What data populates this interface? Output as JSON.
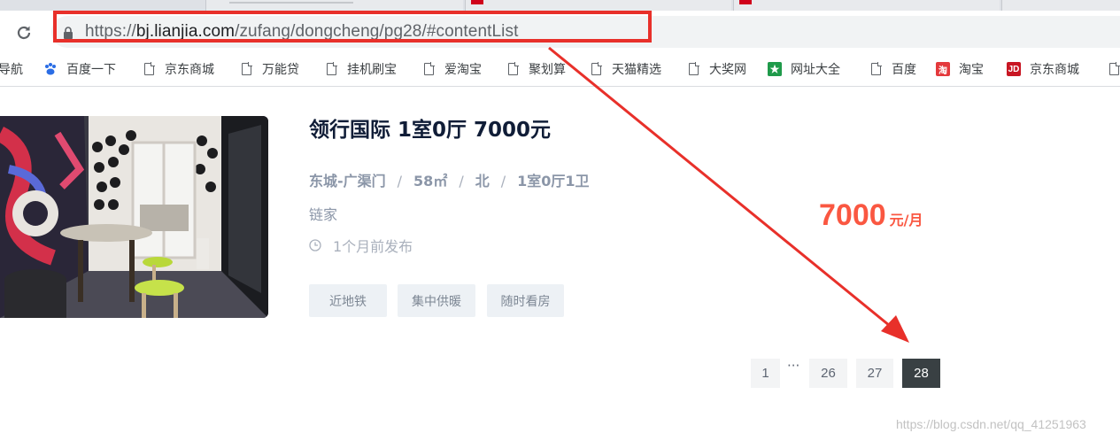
{
  "browser": {
    "url_host_prefix": "https://",
    "url_host": "bj.lianjia.com",
    "url_path": "/zufang/dongcheng/pg28/#contentList"
  },
  "bookmarks": [
    {
      "label": "导航",
      "icon": "page-icon"
    },
    {
      "label": "百度一下",
      "icon": "baidu-paw-icon"
    },
    {
      "label": "京东商城",
      "icon": "page-icon"
    },
    {
      "label": "万能贷",
      "icon": "page-icon"
    },
    {
      "label": "挂机刷宝",
      "icon": "page-icon"
    },
    {
      "label": "爱淘宝",
      "icon": "page-icon"
    },
    {
      "label": "聚划算",
      "icon": "page-icon"
    },
    {
      "label": "天猫精选",
      "icon": "page-icon"
    },
    {
      "label": "大奖网",
      "icon": "page-icon"
    },
    {
      "label": "网址大全",
      "icon": "web-directory-icon"
    },
    {
      "label": "百度",
      "icon": "page-icon"
    },
    {
      "label": "淘宝",
      "icon": "taobao-icon",
      "badge_text": "淘"
    },
    {
      "label": "京东商城",
      "icon": "jd-icon",
      "badge_text": "JD"
    }
  ],
  "listing": {
    "title": "领行国际 1室0厅 7000元",
    "district": "东城-广渠门",
    "separator": "/",
    "area": "58㎡",
    "orientation": "北",
    "layout": "1室0厅1卫",
    "brand": "链家",
    "posted": "1个月前发布",
    "tags": [
      "近地铁",
      "集中供暖",
      "随时看房"
    ],
    "price_value": "7000",
    "price_unit": "元/月"
  },
  "pagination": {
    "pages": [
      "1",
      "26",
      "27",
      "28"
    ],
    "ellipsis": "···",
    "current": "28"
  },
  "colors": {
    "price": "#fa5741",
    "annotation": "#e8302a",
    "active_page": "#394043"
  },
  "watermark": "https://blog.csdn.net/qq_41251963"
}
